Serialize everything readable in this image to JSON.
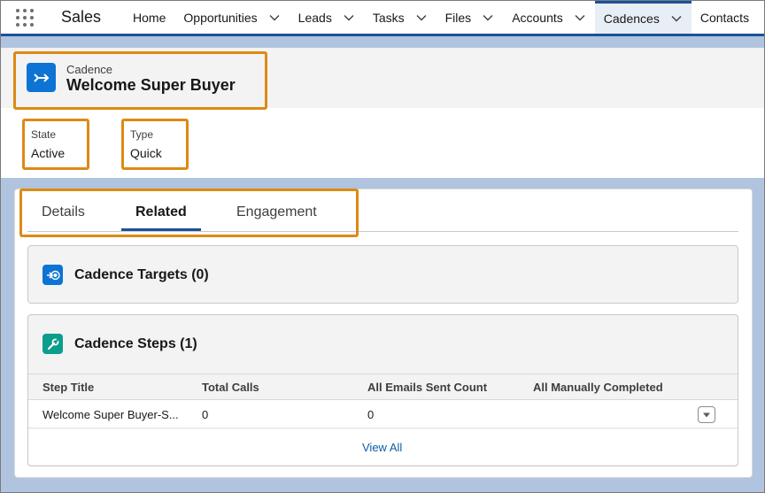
{
  "nav": {
    "app_name": "Sales",
    "items": [
      {
        "label": "Home",
        "has_menu": false
      },
      {
        "label": "Opportunities",
        "has_menu": true
      },
      {
        "label": "Leads",
        "has_menu": true
      },
      {
        "label": "Tasks",
        "has_menu": true
      },
      {
        "label": "Files",
        "has_menu": true
      },
      {
        "label": "Accounts",
        "has_menu": true
      },
      {
        "label": "Cadences",
        "has_menu": true,
        "active": true
      },
      {
        "label": "Contacts",
        "has_menu": false
      }
    ]
  },
  "record": {
    "object_label": "Cadence",
    "title": "Welcome Super Buyer",
    "icon": "cadence-arrow-icon",
    "fields": [
      {
        "label": "State",
        "value": "Active"
      },
      {
        "label": "Type",
        "value": "Quick"
      }
    ]
  },
  "tabs": [
    {
      "label": "Details",
      "selected": false
    },
    {
      "label": "Related",
      "selected": true
    },
    {
      "label": "Engagement",
      "selected": false
    }
  ],
  "related": {
    "targets": {
      "title": "Cadence Targets (0)",
      "icon": "cadence-target-icon"
    },
    "steps": {
      "title": "Cadence Steps (1)",
      "icon": "wrench-icon",
      "columns": [
        "Step Title",
        "Total Calls",
        "All Emails Sent Count",
        "All Manually Completed"
      ],
      "rows": [
        [
          "Welcome Super Buyer-S...",
          "0",
          "0",
          ""
        ]
      ],
      "view_all": "View All"
    }
  },
  "colors": {
    "accent": "#1b5297",
    "highlight": "#dc8a14",
    "icon_blue": "#0d73d4",
    "icon_teal": "#0b9e8c",
    "link": "#0b5cab"
  }
}
